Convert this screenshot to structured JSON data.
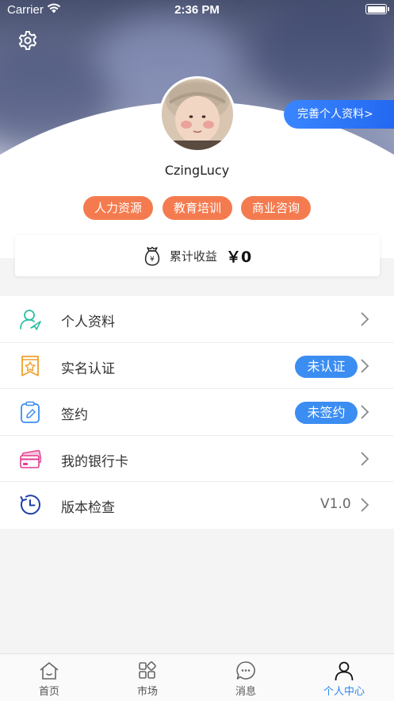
{
  "status_bar": {
    "carrier": "Carrier",
    "time": "2:36 PM"
  },
  "header": {
    "complete_profile_label": "完善个人资料>",
    "username": "CzingLucy",
    "tags": [
      "人力资源",
      "教育培训",
      "商业咨询"
    ]
  },
  "earnings": {
    "label": "累计收益",
    "value": "￥0"
  },
  "menu": [
    {
      "label": "个人资料",
      "icon": "user-profile-icon",
      "badge": "",
      "value": ""
    },
    {
      "label": "实名认证",
      "icon": "certificate-icon",
      "badge": "未认证",
      "value": ""
    },
    {
      "label": "签约",
      "icon": "contract-icon",
      "badge": "未签约",
      "value": ""
    },
    {
      "label": "我的银行卡",
      "icon": "bank-card-icon",
      "badge": "",
      "value": ""
    },
    {
      "label": "版本检查",
      "icon": "clock-icon",
      "badge": "",
      "value": "V1.0"
    }
  ],
  "tabbar": [
    {
      "label": "首页",
      "icon": "home-icon",
      "active": false
    },
    {
      "label": "市场",
      "icon": "market-icon",
      "active": false
    },
    {
      "label": "消息",
      "icon": "message-icon",
      "active": false
    },
    {
      "label": "个人中心",
      "icon": "person-icon",
      "active": true
    }
  ],
  "colors": {
    "accent": "#2f86f2",
    "tag": "#f47b4f",
    "badge": "#3b8df2"
  }
}
